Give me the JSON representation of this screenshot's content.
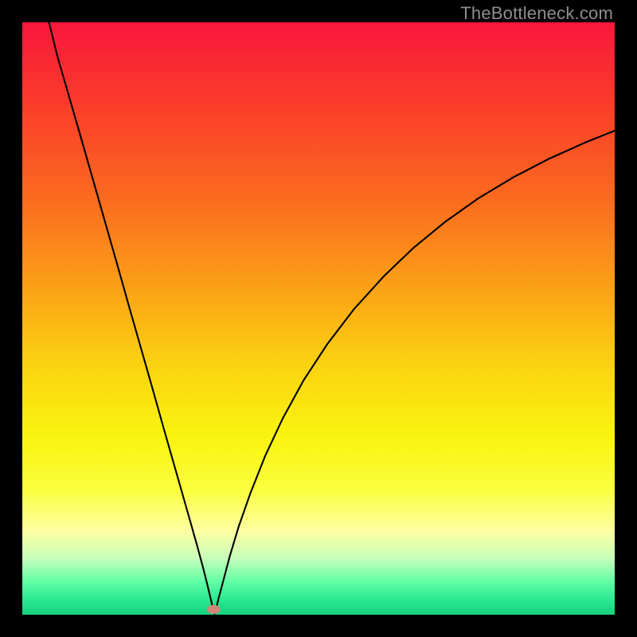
{
  "watermark": "TheBottleneck.com",
  "chart_data": {
    "type": "line",
    "title": "",
    "xlabel": "",
    "ylabel": "",
    "xlim": [
      0,
      100
    ],
    "ylim": [
      0,
      100
    ],
    "background": {
      "type": "vertical-gradient",
      "stops": [
        {
          "offset": 0.0,
          "color": "#fa163c"
        },
        {
          "offset": 0.15,
          "color": "#fb4029"
        },
        {
          "offset": 0.3,
          "color": "#fb6b1f"
        },
        {
          "offset": 0.45,
          "color": "#fba216"
        },
        {
          "offset": 0.58,
          "color": "#fbd311"
        },
        {
          "offset": 0.7,
          "color": "#f9f40f"
        },
        {
          "offset": 0.79,
          "color": "#fbff3f"
        },
        {
          "offset": 0.86,
          "color": "#fcffa3"
        },
        {
          "offset": 0.905,
          "color": "#c7ffba"
        },
        {
          "offset": 0.945,
          "color": "#60fda5"
        },
        {
          "offset": 0.975,
          "color": "#28e98f"
        },
        {
          "offset": 1.0,
          "color": "#15d07d"
        }
      ]
    },
    "curve": {
      "stroke": "#000000",
      "stroke_width": 2.1,
      "points_pct": [
        [
          4.5,
          100.0
        ],
        [
          6.0,
          94.0
        ],
        [
          8.0,
          87.1
        ],
        [
          10.0,
          80.2
        ],
        [
          12.0,
          73.2
        ],
        [
          14.0,
          66.2
        ],
        [
          16.0,
          59.2
        ],
        [
          18.0,
          52.1
        ],
        [
          20.0,
          45.1
        ],
        [
          22.0,
          38.1
        ],
        [
          24.0,
          31.0
        ],
        [
          26.0,
          24.0
        ],
        [
          28.0,
          17.0
        ],
        [
          29.5,
          11.7
        ],
        [
          30.5,
          8.0
        ],
        [
          31.2,
          5.2
        ],
        [
          31.8,
          2.7
        ],
        [
          32.2,
          1.0
        ],
        [
          32.45,
          0.15
        ],
        [
          32.7,
          1.0
        ],
        [
          33.2,
          3.0
        ],
        [
          34.0,
          6.0
        ],
        [
          35.0,
          9.8
        ],
        [
          36.5,
          14.8
        ],
        [
          38.5,
          20.5
        ],
        [
          41.0,
          26.8
        ],
        [
          44.0,
          33.2
        ],
        [
          47.5,
          39.6
        ],
        [
          51.5,
          45.7
        ],
        [
          56.0,
          51.6
        ],
        [
          61.0,
          57.1
        ],
        [
          66.0,
          61.9
        ],
        [
          71.5,
          66.4
        ],
        [
          77.0,
          70.3
        ],
        [
          83.0,
          73.9
        ],
        [
          89.0,
          77.0
        ],
        [
          95.0,
          79.7
        ],
        [
          100.0,
          81.7
        ]
      ]
    },
    "marker": {
      "fill": "#d58576",
      "cx_pct": 32.3,
      "cy_pct": 0.9,
      "rx_pct": 1.1,
      "ry_pct": 0.75
    }
  }
}
